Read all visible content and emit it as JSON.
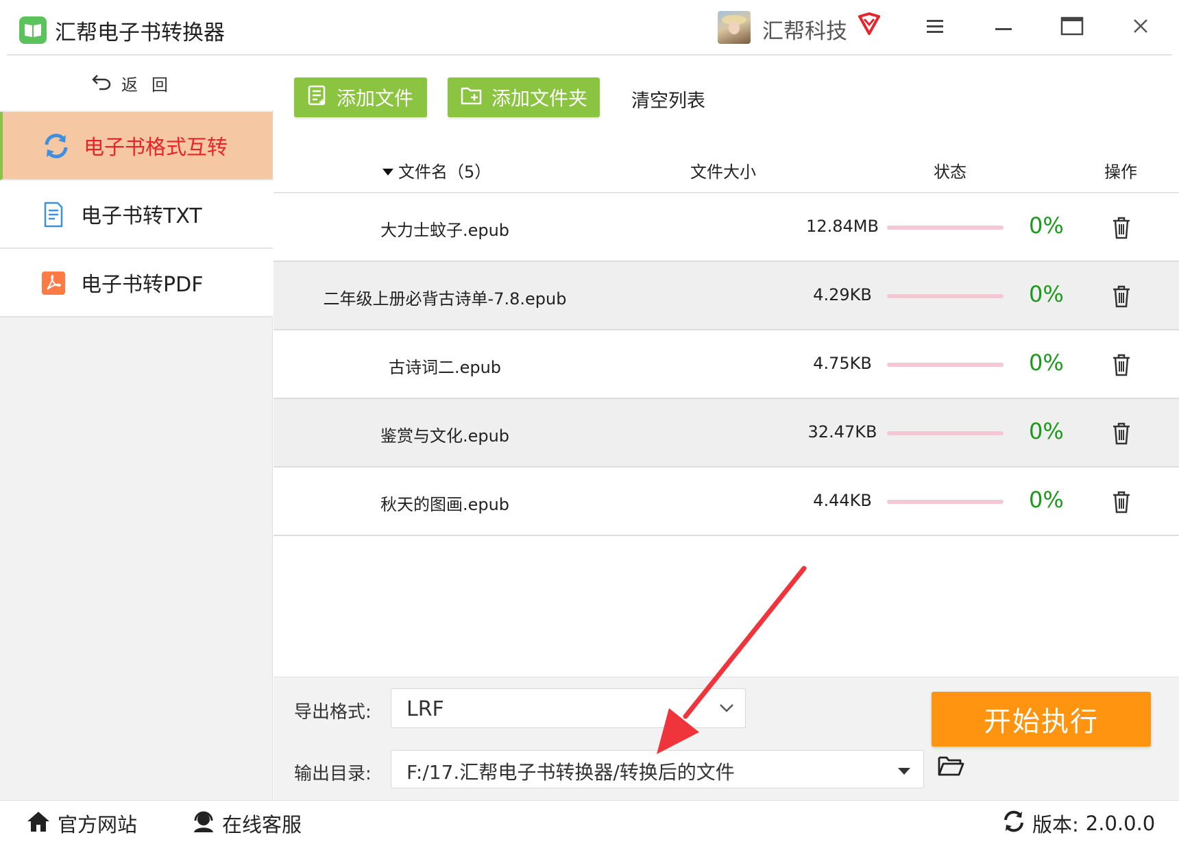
{
  "app": {
    "title": "汇帮电子书转换器",
    "user_name": "汇帮科技",
    "vip_icon": "vip-diamond-icon",
    "colors": {
      "green": "#8bc441",
      "orange": "#ff9410",
      "active_bg": "#f5c7a3",
      "active_text": "#e8232a",
      "progress_pct": "#1a9a1a"
    }
  },
  "window_controls": [
    {
      "name": "menu-button",
      "icon": "hamburger-icon"
    },
    {
      "name": "minimize-button",
      "icon": "minimize-icon"
    },
    {
      "name": "maximize-button",
      "icon": "maximize-icon"
    },
    {
      "name": "close-button",
      "icon": "close-icon"
    }
  ],
  "sidebar": {
    "back_label": "返回",
    "items": [
      {
        "label": "电子书格式互转",
        "icon": "refresh-icon",
        "active": true
      },
      {
        "label": "电子书转TXT",
        "icon": "document-icon",
        "active": false
      },
      {
        "label": "电子书转PDF",
        "icon": "pdf-icon",
        "active": false
      }
    ]
  },
  "toolbar": {
    "add_file_label": "添加文件",
    "add_folder_label": "添加文件夹",
    "clear_label": "清空列表"
  },
  "table": {
    "headers": {
      "name": "文件名（5）",
      "size": "文件大小",
      "status": "状态",
      "action": "操作"
    },
    "rows": [
      {
        "name": "大力士蚊子.epub",
        "size": "12.84MB",
        "status": "0%",
        "progress": 0
      },
      {
        "name": "二年级上册必背古诗单-7.8.epub",
        "size": "4.29KB",
        "status": "0%",
        "progress": 0
      },
      {
        "name": "古诗词二.epub",
        "size": "4.75KB",
        "status": "0%",
        "progress": 0
      },
      {
        "name": "鉴赏与文化.epub",
        "size": "32.47KB",
        "status": "0%",
        "progress": 0
      },
      {
        "name": "秋天的图画.epub",
        "size": "4.44KB",
        "status": "0%",
        "progress": 0
      }
    ]
  },
  "export": {
    "format_label": "导出格式:",
    "format_value": "LRF",
    "dir_label": "输出目录:",
    "dir_value": "F:/17.汇帮电子书转换器/转换后的文件",
    "start_label": "开始执行"
  },
  "statusbar": {
    "website_label": "官方网站",
    "support_label": "在线客服",
    "version_label": "版本:",
    "version_value": "2.0.0.0"
  }
}
